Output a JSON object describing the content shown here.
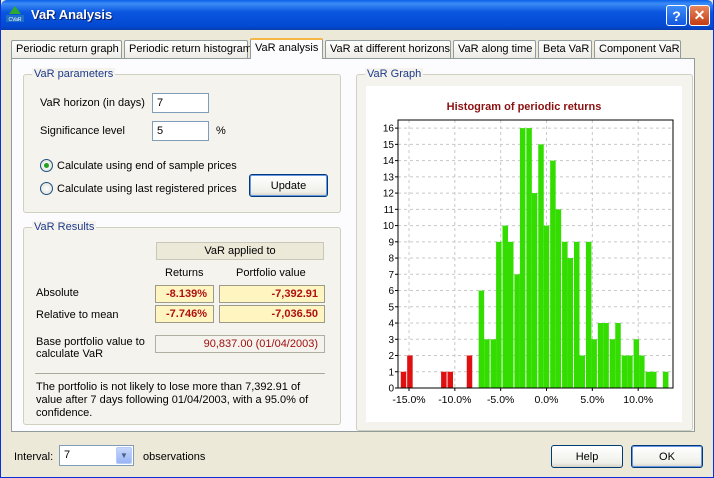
{
  "window": {
    "title": "VaR Analysis",
    "app_icon_text": "CVaR",
    "help_glyph": "?",
    "close_glyph": "✕"
  },
  "tabs": [
    {
      "label": "Periodic return graph",
      "active": false
    },
    {
      "label": "Periodic return histogram",
      "active": false
    },
    {
      "label": "VaR analysis",
      "active": true
    },
    {
      "label": "VaR at different horizons",
      "active": false
    },
    {
      "label": "VaR along time",
      "active": false
    },
    {
      "label": "Beta VaR",
      "active": false
    },
    {
      "label": "Component VaR",
      "active": false
    }
  ],
  "params": {
    "title": "VaR parameters",
    "horizon_label": "VaR horizon (in days)",
    "horizon_value": "7",
    "significance_label": "Significance level",
    "significance_value": "5",
    "significance_unit": "%",
    "radio_end": "Calculate using end of sample prices",
    "radio_last": "Calculate using last registered prices",
    "radio_selected": "end",
    "update_label": "Update"
  },
  "results": {
    "title": "VaR Results",
    "applied_header": "VaR applied to",
    "col_returns": "Returns",
    "col_portfolio": "Portfolio value",
    "row_absolute": "Absolute",
    "row_relative": "Relative to mean",
    "absolute_returns": "-8.139%",
    "absolute_portfolio": "-7,392.91",
    "relative_returns": "-7.746%",
    "relative_portfolio": "-7,036.50",
    "base_label_1": "Base portfolio value to",
    "base_label_2": "calculate VaR",
    "base_value": "90,837.00 (01/04/2003)",
    "summary": "The portfolio is not likely to lose more than 7,392.91 of value after 7 days following 01/04/2003, with a 95.0% of confidence."
  },
  "graph_group": {
    "title": "VaR Graph"
  },
  "footer": {
    "interval_label": "Interval:",
    "interval_value": "7",
    "observations_label": "observations",
    "help_label": "Help",
    "ok_label": "OK"
  },
  "colors": {
    "loss_bar": "#E01010",
    "normal_bar": "#33DD00",
    "chart_title": "#8B1010",
    "accent": "#0A5FE8"
  },
  "chart_data": {
    "type": "bar",
    "title": "Histogram of periodic returns",
    "xlabel": "",
    "ylabel": "",
    "ylim": [
      0,
      16.5
    ],
    "xlim": [
      -16.2,
      13.8
    ],
    "x_ticks": [
      {
        "value": -15,
        "label": "-15.0%"
      },
      {
        "value": -10,
        "label": "-10.0%"
      },
      {
        "value": -5,
        "label": "-5.0%"
      },
      {
        "value": 0,
        "label": "0.0%"
      },
      {
        "value": 5,
        "label": "5.0%"
      },
      {
        "value": 10,
        "label": "10.0%"
      }
    ],
    "y_ticks": [
      0,
      1,
      2,
      3,
      4,
      5,
      6,
      7,
      8,
      9,
      10,
      11,
      12,
      13,
      14,
      15,
      16
    ],
    "grid": true,
    "bin_width": 0.6,
    "var_threshold": -8.139,
    "bins": [
      {
        "x": -15.6,
        "y": 1
      },
      {
        "x": -14.9,
        "y": 2
      },
      {
        "x": -11.2,
        "y": 1
      },
      {
        "x": -10.5,
        "y": 1
      },
      {
        "x": -8.4,
        "y": 2
      },
      {
        "x": -7.1,
        "y": 6
      },
      {
        "x": -6.5,
        "y": 3
      },
      {
        "x": -5.8,
        "y": 3
      },
      {
        "x": -5.2,
        "y": 9
      },
      {
        "x": -4.5,
        "y": 10
      },
      {
        "x": -3.9,
        "y": 9
      },
      {
        "x": -3.2,
        "y": 7
      },
      {
        "x": -2.6,
        "y": 16
      },
      {
        "x": -1.9,
        "y": 16
      },
      {
        "x": -1.3,
        "y": 12
      },
      {
        "x": -0.6,
        "y": 15
      },
      {
        "x": 0.0,
        "y": 10
      },
      {
        "x": 0.7,
        "y": 14
      },
      {
        "x": 1.3,
        "y": 11
      },
      {
        "x": 2.0,
        "y": 9
      },
      {
        "x": 2.6,
        "y": 8
      },
      {
        "x": 3.3,
        "y": 9
      },
      {
        "x": 3.9,
        "y": 2
      },
      {
        "x": 4.6,
        "y": 9
      },
      {
        "x": 5.2,
        "y": 3
      },
      {
        "x": 5.9,
        "y": 4
      },
      {
        "x": 6.5,
        "y": 4
      },
      {
        "x": 7.2,
        "y": 3
      },
      {
        "x": 7.8,
        "y": 4
      },
      {
        "x": 8.5,
        "y": 2
      },
      {
        "x": 9.1,
        "y": 2
      },
      {
        "x": 9.8,
        "y": 3
      },
      {
        "x": 10.4,
        "y": 2
      },
      {
        "x": 11.1,
        "y": 1
      },
      {
        "x": 11.7,
        "y": 1
      },
      {
        "x": 13.0,
        "y": 1
      }
    ]
  }
}
